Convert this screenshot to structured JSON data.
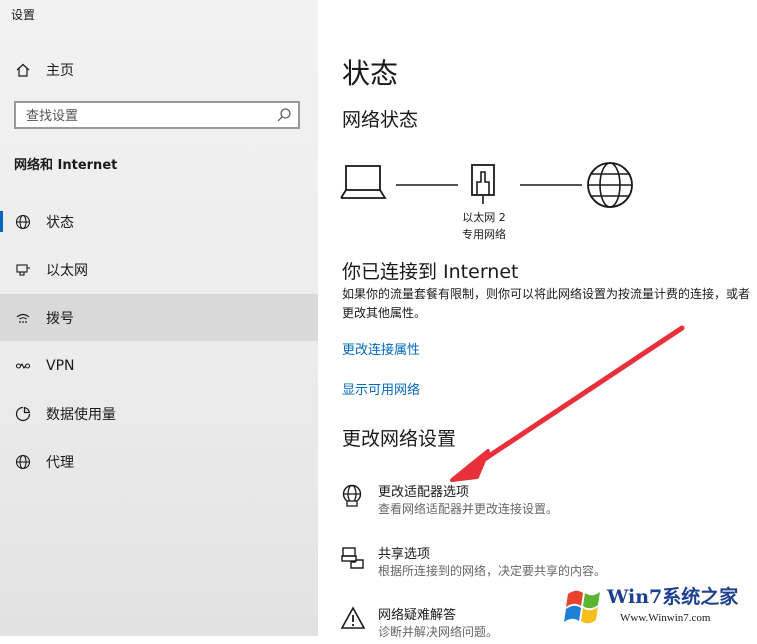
{
  "app": {
    "title": "设置"
  },
  "sidebar": {
    "home_label": "主页",
    "search_placeholder": "查找设置",
    "section_title": "网络和 Internet",
    "items": [
      {
        "label": "状态",
        "icon": "globe-icon"
      },
      {
        "label": "以太网",
        "icon": "ethernet-icon"
      },
      {
        "label": "拨号",
        "icon": "dialup-icon"
      },
      {
        "label": "VPN",
        "icon": "vpn-icon"
      },
      {
        "label": "数据使用量",
        "icon": "data-usage-icon"
      },
      {
        "label": "代理",
        "icon": "globe-icon"
      }
    ]
  },
  "main": {
    "title": "状态",
    "network_status": "网络状态",
    "adapter_name": "以太网 2",
    "network_type": "专用网络",
    "connected_title": "你已连接到 Internet",
    "connected_desc": "如果你的流量套餐有限制，则你可以将此网络设置为按流量计费的连接，或者更改其他属性。",
    "links": {
      "change_props": "更改连接属性",
      "show_networks": "显示可用网络"
    },
    "change_heading": "更改网络设置",
    "options": [
      {
        "title": "更改适配器选项",
        "sub": "查看网络适配器并更改连接设置。",
        "icon": "adapter-icon"
      },
      {
        "title": "共享选项",
        "sub": "根据所连接到的网络，决定要共享的内容。",
        "icon": "sharing-icon"
      },
      {
        "title": "网络疑难解答",
        "sub": "诊断并解决网络问题。",
        "icon": "warning-icon"
      }
    ]
  },
  "watermark": {
    "brand": "Win7系统之家",
    "url": "Www.Winwin7.com"
  },
  "colors": {
    "accent": "#0067c0",
    "arrow": "#e8303a"
  }
}
